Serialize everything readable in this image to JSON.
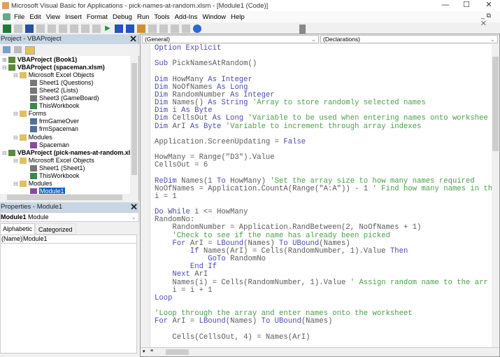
{
  "window": {
    "title": "Microsoft Visual Basic for Applications - pick-names-at-random.xlsm - [Module1 (Code)]",
    "controls": [
      "—",
      "☐",
      "✕"
    ]
  },
  "menu": [
    "File",
    "Edit",
    "View",
    "Insert",
    "Format",
    "Debug",
    "Run",
    "Tools",
    "Add-Ins",
    "Window",
    "Help"
  ],
  "toolbar": [
    "excel-icon",
    "insert-userform-icon",
    "save-icon",
    "cut-icon",
    "copy-icon",
    "paste-icon",
    "find-icon",
    "undo-icon",
    "redo-icon",
    "run-icon",
    "break-icon",
    "reset-icon",
    "design-mode-icon",
    "project-explorer-icon",
    "properties-icon",
    "object-browser-icon",
    "toolbox-icon",
    "help-icon"
  ],
  "project": {
    "title": "Project - VBAProject",
    "tree": [
      {
        "label": "VBAProject (Book1)",
        "level": 0,
        "bold": true,
        "icon": "project",
        "exp": "+"
      },
      {
        "label": "VBAProject (spaceman.xlsm)",
        "level": 0,
        "bold": true,
        "icon": "project",
        "exp": "-"
      },
      {
        "label": "Microsoft Excel Objects",
        "level": 1,
        "icon": "folder",
        "exp": "-"
      },
      {
        "label": "Sheet1 (Questions)",
        "level": 2,
        "icon": "sheet"
      },
      {
        "label": "Sheet2 (Lists)",
        "level": 2,
        "icon": "sheet"
      },
      {
        "label": "Sheet3 (GameBoard)",
        "level": 2,
        "icon": "sheet"
      },
      {
        "label": "ThisWorkbook",
        "level": 2,
        "icon": "workbook"
      },
      {
        "label": "Forms",
        "level": 1,
        "icon": "folder",
        "exp": "-"
      },
      {
        "label": "frmGameOver",
        "level": 2,
        "icon": "form"
      },
      {
        "label": "frmSpaceman",
        "level": 2,
        "icon": "form"
      },
      {
        "label": "Modules",
        "level": 1,
        "icon": "folder",
        "exp": "-"
      },
      {
        "label": "Spaceman",
        "level": 2,
        "icon": "module"
      },
      {
        "label": "VBAProject (pick-names-at-random.xlsm)",
        "level": 0,
        "bold": true,
        "icon": "project",
        "exp": "-"
      },
      {
        "label": "Microsoft Excel Objects",
        "level": 1,
        "icon": "folder",
        "exp": "-"
      },
      {
        "label": "Sheet1 (Sheet1)",
        "level": 2,
        "icon": "sheet"
      },
      {
        "label": "ThisWorkbook",
        "level": 2,
        "icon": "workbook"
      },
      {
        "label": "Modules",
        "level": 1,
        "icon": "folder",
        "exp": "-"
      },
      {
        "label": "Module1",
        "level": 2,
        "icon": "module",
        "selected": true
      }
    ]
  },
  "properties": {
    "title": "Properties - Module1",
    "object_name": "Module1",
    "object_type": "Module",
    "tabs": [
      "Alphabetic",
      "Categorized"
    ],
    "rows": [
      {
        "name": "(Name)",
        "value": "Module1"
      }
    ]
  },
  "code": {
    "object": "(General)",
    "procedure": "(Declarations)",
    "lines": [
      [
        [
          "kw",
          "Option Explicit"
        ]
      ],
      [],
      [
        [
          "kw",
          "Sub "
        ],
        [
          "t",
          "PickNamesAtRandom()"
        ]
      ],
      [],
      [
        [
          "kw",
          "Dim "
        ],
        [
          "t",
          "HowMany "
        ],
        [
          "kw",
          "As Integer"
        ]
      ],
      [
        [
          "kw",
          "Dim "
        ],
        [
          "t",
          "NoOfNames "
        ],
        [
          "kw",
          "As Long"
        ]
      ],
      [
        [
          "kw",
          "Dim "
        ],
        [
          "t",
          "RandomNumber "
        ],
        [
          "kw",
          "As Integer"
        ]
      ],
      [
        [
          "kw",
          "Dim "
        ],
        [
          "t",
          "Names() "
        ],
        [
          "kw",
          "As String "
        ],
        [
          "cm",
          "'Array to store randomly selected names"
        ]
      ],
      [
        [
          "kw",
          "Dim "
        ],
        [
          "t",
          "i "
        ],
        [
          "kw",
          "As Byte"
        ]
      ],
      [
        [
          "kw",
          "Dim "
        ],
        [
          "t",
          "CellsOut "
        ],
        [
          "kw",
          "As Long "
        ],
        [
          "cm",
          "'Variable to be used when entering names onto workshee"
        ]
      ],
      [
        [
          "kw",
          "Dim "
        ],
        [
          "t",
          "ArI "
        ],
        [
          "kw",
          "As Byte "
        ],
        [
          "cm",
          "'Variable to increment through array indexes"
        ]
      ],
      [],
      [
        [
          "t",
          "Application.ScreenUpdating = "
        ],
        [
          "kw",
          "False"
        ]
      ],
      [],
      [
        [
          "t",
          "HowMany = Range(\"D3\").Value"
        ]
      ],
      [
        [
          "t",
          "CellsOut = 6"
        ]
      ],
      [],
      [
        [
          "kw",
          "ReDim "
        ],
        [
          "t",
          "Names(1 "
        ],
        [
          "kw",
          "To "
        ],
        [
          "t",
          "HowMany) "
        ],
        [
          "cm",
          "'Set the array size to how many names required"
        ]
      ],
      [
        [
          "t",
          "NoOfNames = Application.CountA(Range(\"A:A\")) - 1 "
        ],
        [
          "cm",
          "' Find how many names in th"
        ]
      ],
      [
        [
          "t",
          "i = 1"
        ]
      ],
      [],
      [
        [
          "kw",
          "Do While "
        ],
        [
          "t",
          "i <= HowMany"
        ]
      ],
      [
        [
          "t",
          "RandomNo:"
        ]
      ],
      [
        [
          "t",
          "    RandomNumber = Application.RandBetween(2, NoOfNames + 1)"
        ]
      ],
      [
        [
          "cm",
          "    'Check to see if the name has already been picked"
        ]
      ],
      [
        [
          "kw",
          "    For "
        ],
        [
          "t",
          "ArI = "
        ],
        [
          "kw",
          "LBound"
        ],
        [
          "t",
          "(Names) "
        ],
        [
          "kw",
          "To UBound"
        ],
        [
          "t",
          "(Names)"
        ]
      ],
      [
        [
          "kw",
          "        If "
        ],
        [
          "t",
          "Names(ArI) = Cells(RandomNumber, 1).Value "
        ],
        [
          "kw",
          "Then"
        ]
      ],
      [
        [
          "kw",
          "            GoTo "
        ],
        [
          "t",
          "RandomNo"
        ]
      ],
      [
        [
          "kw",
          "        End If"
        ]
      ],
      [
        [
          "kw",
          "    Next "
        ],
        [
          "t",
          "ArI"
        ]
      ],
      [
        [
          "t",
          "    Names(i) = Cells(RandomNumber, 1).Value "
        ],
        [
          "cm",
          "' Assign random name to the arr"
        ]
      ],
      [
        [
          "t",
          "    i = i + 1"
        ]
      ],
      [
        [
          "kw",
          "Loop"
        ]
      ],
      [],
      [
        [
          "cm",
          "'Loop through the array and enter names onto the worksheet"
        ]
      ],
      [
        [
          "kw",
          "For "
        ],
        [
          "t",
          "ArI = "
        ],
        [
          "kw",
          "LBound"
        ],
        [
          "t",
          "(Names) "
        ],
        [
          "kw",
          "To UBound"
        ],
        [
          "t",
          "(Names)"
        ]
      ],
      [],
      [
        [
          "t",
          "    Cells(CellsOut, 4) = Names(ArI)"
        ]
      ]
    ]
  },
  "colors": {
    "keyword": "#4b4bb0",
    "comment": "#4a9e4a",
    "text": "#5a5a5a",
    "panel_title": "#c7d6e5",
    "selection": "#0a64c8"
  }
}
